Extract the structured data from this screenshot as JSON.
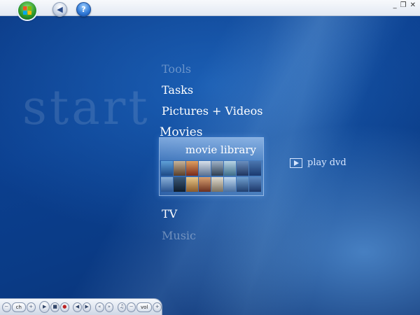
{
  "topbar": {
    "back_icon": "back-arrow-icon",
    "help_icon": "help-icon",
    "window_controls": {
      "minimize": "_",
      "restore": "❐",
      "close": "✕"
    }
  },
  "watermark": "start",
  "menu": {
    "items": [
      {
        "label": "Tools",
        "state": "dim"
      },
      {
        "label": "Tasks",
        "state": "normal"
      },
      {
        "label": "Pictures + Videos",
        "state": "normal"
      },
      {
        "label": "Movies",
        "state": "active"
      },
      {
        "label": "TV",
        "state": "normal"
      },
      {
        "label": "Music",
        "state": "dim"
      }
    ]
  },
  "strip": {
    "selected": "movie library",
    "secondary": "play dvd"
  },
  "transport": {
    "channel_label": "ch",
    "volume_label": "vol",
    "minus": "−",
    "plus": "+"
  },
  "colors": {
    "background": "#0b3a86",
    "text": "#ffffff",
    "accent": "#9cc8ff"
  }
}
